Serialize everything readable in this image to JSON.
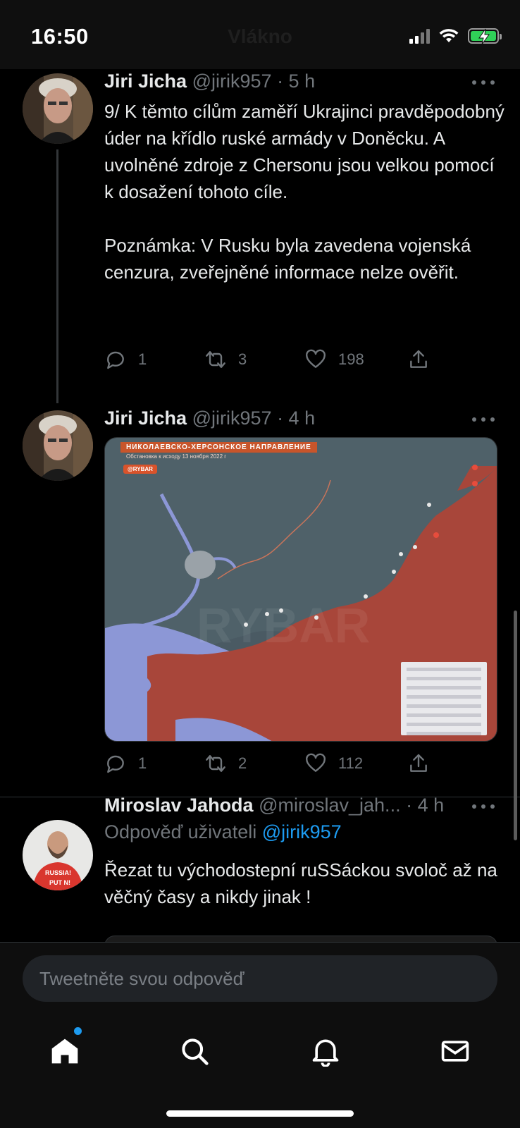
{
  "status_bar": {
    "time": "16:50",
    "ghost_title": "Vlákno"
  },
  "tweets": [
    {
      "name": "Jiri Jicha",
      "handle": "@jirik957",
      "time": "· 5 h",
      "text": "9/ K těmto cílům zaměří Ukrajinci pravděpodobný úder na křídlo ruské armády v Doněcku. A uvolněné zdroje z Chersonu jsou velkou pomocí k dosažení tohoto cíle.\n\nPoznámka:  V Rusku byla zavedena vojenská cenzura, zveřejněné informace nelze ověřit.",
      "replies": "1",
      "retweets": "3",
      "likes": "198"
    },
    {
      "name": "Jiri Jicha",
      "handle": "@jirik957",
      "time": "· 4 h",
      "media": {
        "title": "НИКОЛАЕВСКО-ХЕРСОНСКОЕ НАПРАВЛЕНИЕ",
        "subtitle": "Обстановка к исходу 13 ноября 2022 г",
        "logo": "@RYBAR"
      },
      "replies": "1",
      "retweets": "2",
      "likes": "112"
    },
    {
      "name": "Miroslav Jahoda",
      "handle": "@miroslav_jah...",
      "time": "· 4 h",
      "reply_prefix": "Odpověď uživateli",
      "reply_to": "@jirik957",
      "text": "Řezat tu východostepní ruSSáckou svoloč až na věčný časy a nikdy jinak !"
    }
  ],
  "reply_box": {
    "placeholder": "Tweetněte svou odpověď"
  },
  "tabbar": {
    "items": [
      "home-icon",
      "search-icon",
      "bell-icon",
      "mail-icon"
    ]
  },
  "colors": {
    "accent": "#1d9bf0",
    "background": "#000000",
    "muted": "#71767b",
    "battery": "#30d158"
  }
}
